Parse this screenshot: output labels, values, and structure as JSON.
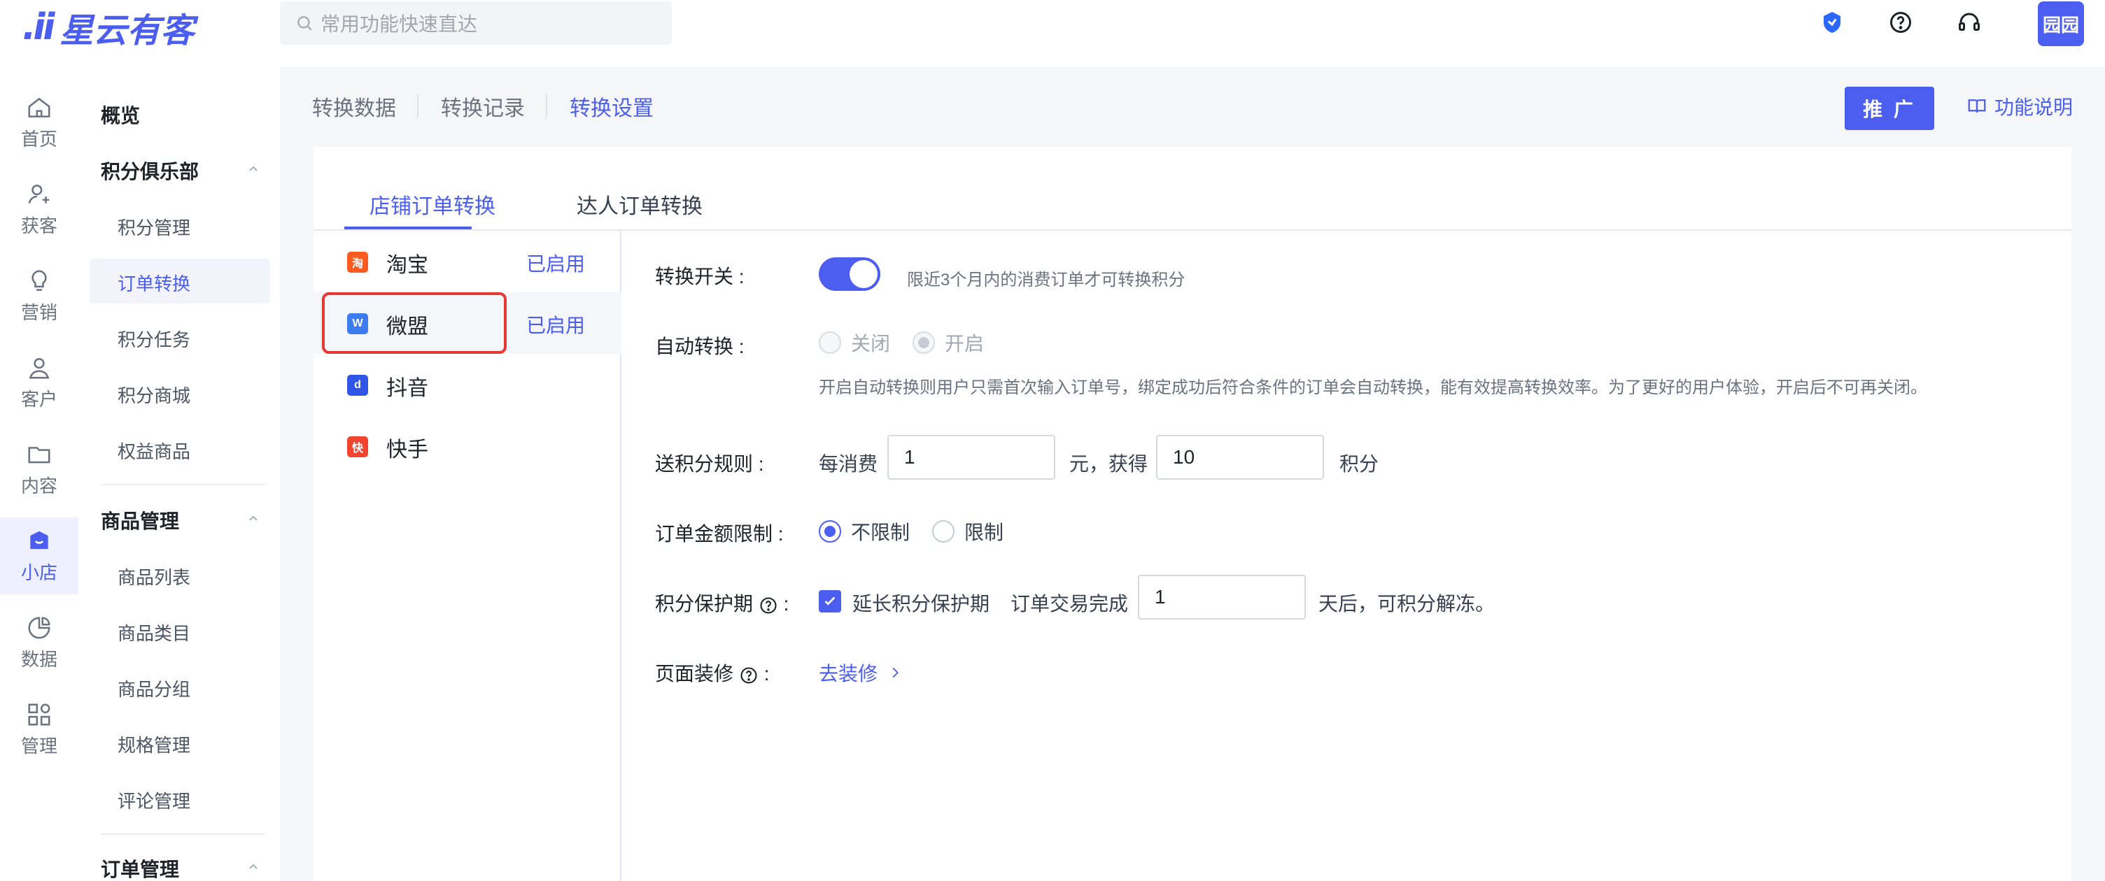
{
  "brand": {
    "mark": ".ii",
    "name": "星云有客"
  },
  "search": {
    "placeholder": "常用功能快速直达"
  },
  "user": {
    "avatar_text": "园园"
  },
  "rail": [
    {
      "label": "首页",
      "icon": "home-icon"
    },
    {
      "label": "获客",
      "icon": "user-add-icon"
    },
    {
      "label": "营销",
      "icon": "bulb-icon"
    },
    {
      "label": "客户",
      "icon": "user-icon"
    },
    {
      "label": "内容",
      "icon": "folder-icon"
    },
    {
      "label": "小店",
      "icon": "shop-icon",
      "active": true
    },
    {
      "label": "数据",
      "icon": "pie-chart-icon"
    },
    {
      "label": "管理",
      "icon": "apps-icon"
    }
  ],
  "menu": {
    "overview": "概览",
    "groups": [
      {
        "title": "积分俱乐部",
        "items": [
          "积分管理",
          "订单转换",
          "积分任务",
          "积分商城",
          "权益商品"
        ]
      },
      {
        "title": "商品管理",
        "items": [
          "商品列表",
          "商品类目",
          "商品分组",
          "规格管理",
          "评论管理"
        ]
      },
      {
        "title": "订单管理",
        "items": []
      }
    ],
    "active_item": "订单转换"
  },
  "header": {
    "tabs": [
      "转换数据",
      "转换记录",
      "转换设置"
    ],
    "active_tab": "转换设置",
    "promote_label": "推 广",
    "help_label": "功能说明"
  },
  "subtabs": [
    "店铺订单转换",
    "达人订单转换"
  ],
  "platforms": [
    {
      "name": "淘宝",
      "status": "已启用",
      "icon_text": "淘",
      "color": "#ff5a1f"
    },
    {
      "name": "微盟",
      "status": "已启用",
      "icon_text": "W",
      "color": "#3b7cf0"
    },
    {
      "name": "抖音",
      "status": "",
      "icon_text": "d",
      "color": "#2f56e6"
    },
    {
      "name": "快手",
      "status": "",
      "icon_text": "快",
      "color": "#f0442e"
    }
  ],
  "form": {
    "switch_label": "转换开关 :",
    "switch_hint": "限近3个月内的消费订单才可转换积分",
    "auto_label": "自动转换 :",
    "auto_off": "关闭",
    "auto_on": "开启",
    "auto_hint": "开启自动转换则用户只需首次输入订单号，绑定成功后符合条件的订单会自动转换，能有效提高转换效率。为了更好的用户体验，开启后不可再关闭。",
    "rule_label": "送积分规则 :",
    "rule_prefix": "每消费",
    "rule_amount": "1",
    "rule_mid": "元，获得",
    "rule_points": "10",
    "rule_suffix": "积分",
    "limit_label": "订单金额限制 :",
    "limit_none": "不限制",
    "limit_yes": "限制",
    "protect_label": "积分保护期",
    "protect_check": "延长积分保护期",
    "protect_prefix": "订单交易完成",
    "protect_days": "1",
    "protect_suffix": "天后，可积分解冻。",
    "decor_label": "页面装修",
    "decor_link": "去装修"
  },
  "colors": {
    "primary": "#4b5ef0",
    "highlight": "#e53935"
  }
}
